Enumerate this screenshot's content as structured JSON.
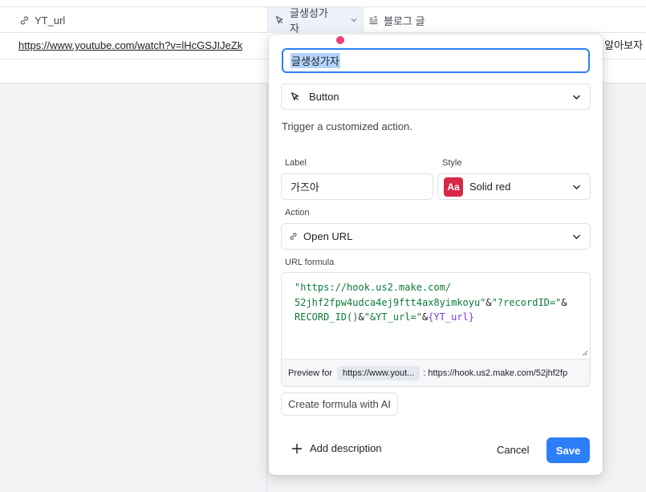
{
  "grid": {
    "columns": [
      {
        "name": "YT_url",
        "icon": "link-icon"
      },
      {
        "name": "글생성가자",
        "icon": "cursor-icon"
      },
      {
        "name": "블로그 글",
        "icon": "long-text-icon"
      }
    ],
    "row": {
      "url": "https://www.youtube.com/watch?v=lHcGSJIJeZk",
      "blog_partial": "를 알아보자"
    }
  },
  "dialog": {
    "field_name": "글생성가자",
    "field_type": "Button",
    "type_description": "Trigger a customized action.",
    "label_title": "Label",
    "label_value": "가즈아",
    "style_title": "Style",
    "style_badge": "Aa",
    "style_value": "Solid red",
    "action_title": "Action",
    "action_value": "Open URL",
    "url_formula_title": "URL formula",
    "formula": {
      "line1_str": "\"https://hook.us2.make.com/",
      "line2_str": "52jhf2fpw4udca4ej9ftt4ax8yimkoyu\"",
      "line2_op": "&",
      "line2_str2": "\"?recordID=\"",
      "line2_op2": "&",
      "line3_fn": "RECORD_ID()",
      "line3_op": "&",
      "line3_str": "\"&YT_url=\"",
      "line3_op2": "&",
      "line3_field": "{YT_url}"
    },
    "preview_label": "Preview for",
    "preview_record": "https://www.yout...",
    "preview_result": ": https://hook.us2.make.com/52jhf2fp",
    "ai_button": "Create formula with AI",
    "add_description": "Add description",
    "cancel": "Cancel",
    "save": "Save"
  },
  "colors": {
    "accent": "#2d7ff9",
    "solid_red": "#d8284a",
    "string": "#0d7a3a",
    "field_ref": "#7c37ef",
    "marker": "#ee3f77"
  }
}
